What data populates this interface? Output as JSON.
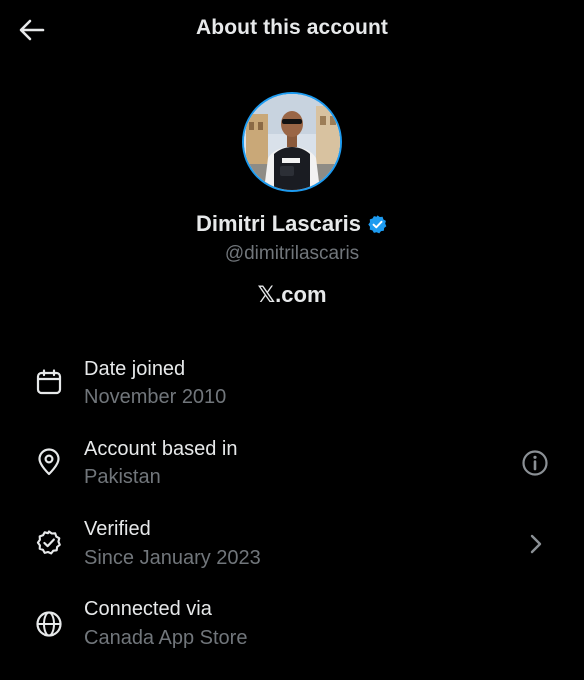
{
  "header": {
    "title": "About this account",
    "back_icon": "arrow-left-icon"
  },
  "profile": {
    "name": "Dimitri Lascaris",
    "handle": "@dimitrilascaris",
    "verified": true,
    "badge_color": "#1d9bf0",
    "site": "𝕏.com"
  },
  "details": [
    {
      "icon": "calendar-icon",
      "title": "Date joined",
      "value": "November 2010"
    },
    {
      "icon": "location-pin-icon",
      "title": "Account based in",
      "value": "Pakistan",
      "trailing_icon": "info-icon"
    },
    {
      "icon": "verified-seal-icon",
      "title": "Verified",
      "value": "Since January 2023",
      "trailing_icon": "chevron-right-icon"
    },
    {
      "icon": "globe-icon",
      "title": "Connected via",
      "value": "Canada App Store"
    }
  ],
  "colors": {
    "background": "#000000",
    "primary_text": "#e7e9ea",
    "secondary_text": "#71767b",
    "accent": "#1d9bf0"
  }
}
